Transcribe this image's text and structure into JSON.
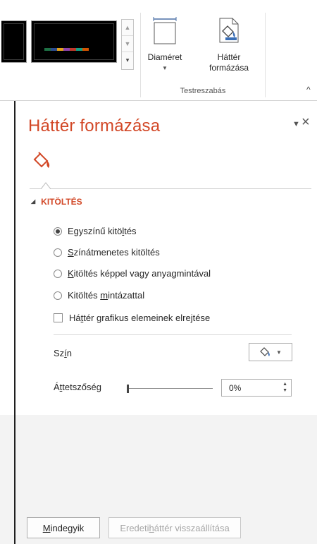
{
  "ribbon": {
    "slide_size_label": "Diaméret",
    "format_background_line1": "Háttér",
    "format_background_line2": "formázása",
    "group_label": "Testreszabás",
    "theme_bar_colors": [
      "#1e7145",
      "#2c4c8f",
      "#e3a21a",
      "#8e44ad",
      "#c0392b",
      "#16a085",
      "#d35400"
    ]
  },
  "pane": {
    "title": "Háttér formázása",
    "menu_icon": "caret-down-icon",
    "close_icon": "close-icon",
    "tab_icon": "paint-bucket-icon",
    "section_title": "KITÖLTÉS",
    "fill_options": [
      {
        "pre": "Egyszínű kitö",
        "key": "l",
        "post": "tés",
        "selected": true
      },
      {
        "pre": "",
        "key": "S",
        "post": "zínátmenetes kitöltés",
        "selected": false
      },
      {
        "pre": "",
        "key": "K",
        "post": "itöltés képpel vagy anyagmintával",
        "selected": false
      },
      {
        "pre": "Kitöltés ",
        "key": "m",
        "post": "intázattal",
        "selected": false
      }
    ],
    "hide_graphics": {
      "pre": "Há",
      "key": "t",
      "post": "tér grafikus elemeinek elrejtése",
      "checked": false
    },
    "color_label": {
      "pre": "Sz",
      "key": "í",
      "post": "n"
    },
    "transparency_label": {
      "pre": "Á",
      "key": "t",
      "post": "tetszőség"
    },
    "transparency_value": "0%",
    "apply_all": {
      "key": "M",
      "post": "indegyik"
    },
    "reset": {
      "pre": "Eredeti ",
      "key": "h",
      "post": "áttér visszaállítása"
    },
    "accent_color": "#d24726"
  }
}
